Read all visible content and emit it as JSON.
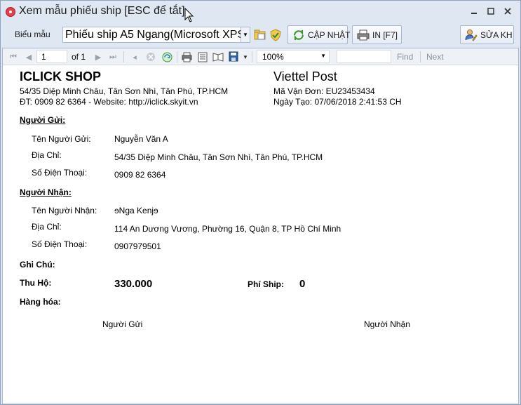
{
  "window": {
    "title": "Xem mẫu phiếu ship [ESC để tắt]",
    "controls": [
      "minimize",
      "maximize",
      "close"
    ]
  },
  "toolbar": {
    "template_label": "Biểu mẫu",
    "template_value": "Phiếu ship A5 Ngang(Microsoft XPS",
    "update_label": "CẬP NHẬT",
    "print_label": "IN [F7]",
    "edit_label": "SỬA KH"
  },
  "navigation": {
    "page_value": "1",
    "page_of": "of 1",
    "zoom_value": "100%",
    "find_label": "Find",
    "next_label": "Next"
  },
  "document": {
    "shop_name": "ICLICK SHOP",
    "shop_address": "54/35 Diệp Minh Châu, Tân Sơn Nhì, Tân Phú, TP.HCM",
    "shop_contact": "ĐT: 0909 82 6364 - Website: http://iclick.skyit.vn",
    "carrier_name": "Viettel Post",
    "tracking_code": "Mã Vận Đơn: EU23453434",
    "created_date": "Ngày Tạo: 07/06/2018 2:41:53 CH",
    "sender_heading": "Người Gửi:",
    "sender": {
      "name_label": "Tên Người Gửi:",
      "name_value": "Nguyễn Văn A",
      "address_label": "Địa Chỉ:",
      "address_value": "54/35 Diệp Minh Châu, Tân Sơn Nhì, Tân Phú, TP.HCM",
      "phone_label": "Số Điện Thoại:",
      "phone_value": "0909 82 6364"
    },
    "receiver_heading": "Người Nhận:",
    "receiver": {
      "name_label": "Tên Người Nhận:",
      "name_value": "ɘNga Kenjɘ",
      "address_label": "Địa Chỉ:",
      "address_value": "114 An Dương Vương, Phường 16, Quận 8, TP Hồ Chí Minh",
      "phone_label": "Số Điện Thoại:",
      "phone_value": "0907979501"
    },
    "note_label": "Ghi Chú:",
    "cod_label": "Thu Hộ:",
    "cod_value": "330.000",
    "ship_fee_label": "Phí Ship:",
    "ship_fee_value": "0",
    "goods_label": "Hàng hóa:",
    "signature_sender": "Người Gửi",
    "signature_receiver": "Người Nhận"
  },
  "colors": {
    "window_bg": "#dfe7f2",
    "accent_green": "#3a9a2a",
    "app_icon_red": "#e0404a"
  }
}
